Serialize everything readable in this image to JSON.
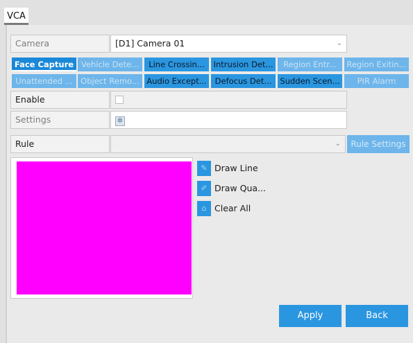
{
  "window": {
    "tab_title": "VCA"
  },
  "camera": {
    "label": "Camera",
    "value": "[D1] Camera 01"
  },
  "detection_buttons": [
    {
      "label": "Face Capture",
      "state": "active"
    },
    {
      "label": "Vehicle Dete...",
      "state": "disabled"
    },
    {
      "label": "Line Crossin...",
      "state": "normal"
    },
    {
      "label": "Intrusion Det...",
      "state": "normal"
    },
    {
      "label": "Region Entr...",
      "state": "disabled"
    },
    {
      "label": "Region Exitin...",
      "state": "disabled"
    },
    {
      "label": "Unattended ...",
      "state": "disabled"
    },
    {
      "label": "Object Remo...",
      "state": "disabled"
    },
    {
      "label": "Audio Except...",
      "state": "normal"
    },
    {
      "label": "Defocus Det...",
      "state": "normal"
    },
    {
      "label": "Sudden Scen...",
      "state": "normal"
    },
    {
      "label": "PIR Alarm",
      "state": "disabled"
    }
  ],
  "enable": {
    "label": "Enable",
    "checked": false
  },
  "settings": {
    "label": "Settings",
    "icon": "gear-icon"
  },
  "rule": {
    "label": "Rule",
    "value": "",
    "settings_button": "Rule Settings"
  },
  "tools": {
    "draw_line": "Draw Line",
    "draw_quad": "Draw Qua...",
    "clear_all": "Clear All"
  },
  "colors": {
    "accent": "#2a96e0",
    "preview_fill": "#ff00ff"
  },
  "footer": {
    "apply": "Apply",
    "back": "Back"
  }
}
